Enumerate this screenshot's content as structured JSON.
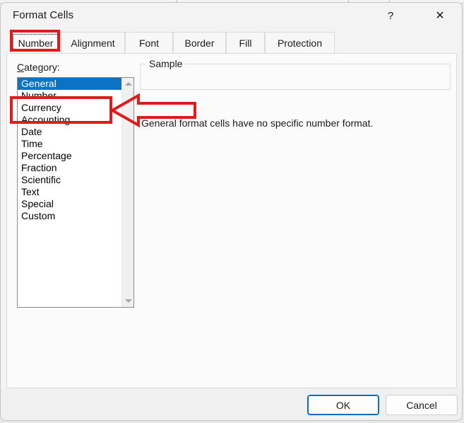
{
  "window": {
    "title": "Format Cells",
    "help_icon": "?",
    "close_icon": "✕"
  },
  "tabs": [
    {
      "label": "Number",
      "active": true
    },
    {
      "label": "Alignment",
      "active": false
    },
    {
      "label": "Font",
      "active": false
    },
    {
      "label": "Border",
      "active": false
    },
    {
      "label": "Fill",
      "active": false
    },
    {
      "label": "Protection",
      "active": false
    }
  ],
  "number_tab": {
    "category_label_accel": "C",
    "category_label_rest": "ategory:",
    "categories": [
      {
        "label": "General",
        "selected": true
      },
      {
        "label": "Number",
        "selected": false
      },
      {
        "label": "Currency",
        "selected": false
      },
      {
        "label": "Accounting",
        "selected": false
      },
      {
        "label": "Date",
        "selected": false
      },
      {
        "label": "Time",
        "selected": false
      },
      {
        "label": "Percentage",
        "selected": false
      },
      {
        "label": "Fraction",
        "selected": false
      },
      {
        "label": "Scientific",
        "selected": false
      },
      {
        "label": "Text",
        "selected": false
      },
      {
        "label": "Special",
        "selected": false
      },
      {
        "label": "Custom",
        "selected": false
      }
    ],
    "sample_legend": "Sample",
    "sample_value": "",
    "description": "General format cells have no specific number format."
  },
  "footer": {
    "ok_label": "OK",
    "cancel_label": "Cancel"
  },
  "annotations": {
    "color": "#e01b1b",
    "tab_highlight_target": "Number",
    "category_highlight_targets": "Currency, Accounting",
    "arrow_direction": "left"
  },
  "colors": {
    "selection_blue": "#0b72c4",
    "annotation_red": "#e01b1b",
    "default_button_border": "#0f6cbd",
    "dialog_background": "#f3f3f3",
    "panel_background": "#fbfbfb"
  }
}
